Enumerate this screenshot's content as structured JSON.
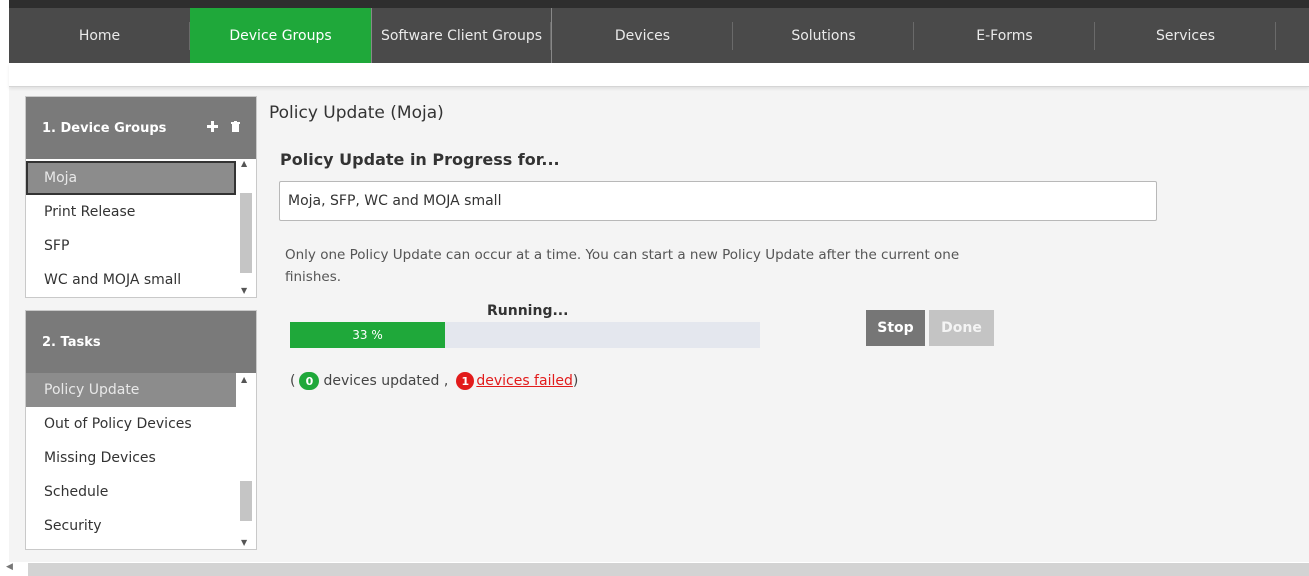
{
  "nav": {
    "items": [
      {
        "label": "Home"
      },
      {
        "label": "Device Groups"
      },
      {
        "label": "Software Client Groups"
      },
      {
        "label": "Devices"
      },
      {
        "label": "Solutions"
      },
      {
        "label": "E-Forms"
      },
      {
        "label": "Services"
      }
    ],
    "active_index": 1
  },
  "device_groups_panel": {
    "title": "1. Device Groups",
    "items": [
      {
        "label": "Moja"
      },
      {
        "label": "Print Release"
      },
      {
        "label": "SFP"
      },
      {
        "label": "WC and MOJA small"
      }
    ],
    "selected_index": 0,
    "add_icon": "plus-icon",
    "delete_icon": "trash-icon"
  },
  "tasks_panel": {
    "title": "2. Tasks",
    "items": [
      {
        "label": "Policy Update"
      },
      {
        "label": "Out of Policy Devices"
      },
      {
        "label": "Missing Devices"
      },
      {
        "label": "Schedule"
      },
      {
        "label": "Security"
      }
    ],
    "selected_index": 0
  },
  "main": {
    "page_title": "Policy Update (Moja)",
    "section_title": "Policy Update in Progress for...",
    "groups_value": "Moja, SFP, WC and MOJA small",
    "info": "Only one Policy Update can occur at a time. You can start a new Policy Update after the current one finishes.",
    "status": "Running...",
    "progress_label": "33 %",
    "progress_fraction": 0.33,
    "stop_label": "Stop",
    "done_label": "Done",
    "updated_count": "0",
    "updated_text": "devices updated ,",
    "failed_count": "1",
    "failed_text": " devices failed ",
    "open_paren": "(",
    "close_paren": ")"
  },
  "colors": {
    "accent": "#1fa83a",
    "danger": "#e21b1b",
    "nav_bg": "#4a4a4a",
    "panel_header": "#7a7a7a"
  }
}
